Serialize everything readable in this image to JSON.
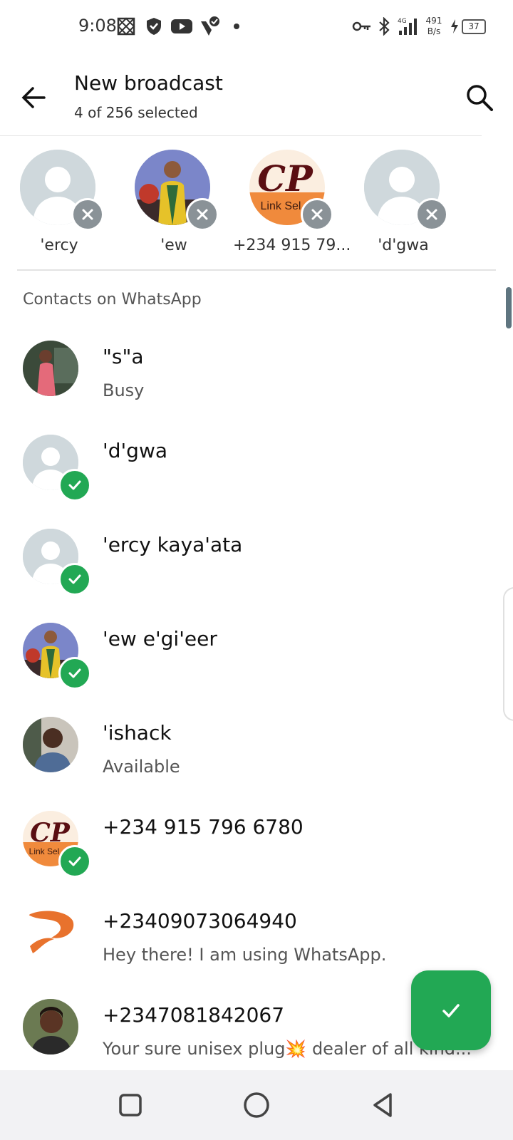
{
  "status_bar": {
    "time": "9:08",
    "network_type": "4G",
    "speed_value": "491",
    "speed_unit": "B/s",
    "battery": "37"
  },
  "header": {
    "title": "New broadcast",
    "subtitle": "4 of 256 selected"
  },
  "selected": [
    {
      "name": "'ercy",
      "avatar": "default"
    },
    {
      "name": "'ew",
      "avatar": "photo"
    },
    {
      "name": "+234 915 79...",
      "avatar": "cp-logo",
      "logo_text": "CP",
      "logo_sub": "Link Sel"
    },
    {
      "name": "'d'gwa",
      "avatar": "default"
    }
  ],
  "section_label": "Contacts on WhatsApp",
  "contacts": [
    {
      "name": "\"s\"a",
      "status": "Busy",
      "checked": false,
      "avatar": "photo"
    },
    {
      "name": "'d'gwa",
      "status": "",
      "checked": true,
      "avatar": "default"
    },
    {
      "name": "'ercy kaya'ata",
      "status": "",
      "checked": true,
      "avatar": "default"
    },
    {
      "name": "'ew e'gi'eer",
      "status": "",
      "checked": true,
      "avatar": "photo"
    },
    {
      "name": "'ishack",
      "status": "Available",
      "checked": false,
      "avatar": "photo"
    },
    {
      "name": "+234 915 796 6780",
      "status": "",
      "checked": true,
      "avatar": "cp-logo"
    },
    {
      "name": "+23409073064940",
      "status": "Hey there! I am using WhatsApp.",
      "checked": false,
      "avatar": "orange-logo"
    },
    {
      "name": "+2347081842067",
      "status": "Your sure unisex plug💥 dealer of all kind...",
      "checked": false,
      "avatar": "photo"
    }
  ],
  "colors": {
    "accent": "#22a854",
    "remove_badge": "#8a9297"
  }
}
